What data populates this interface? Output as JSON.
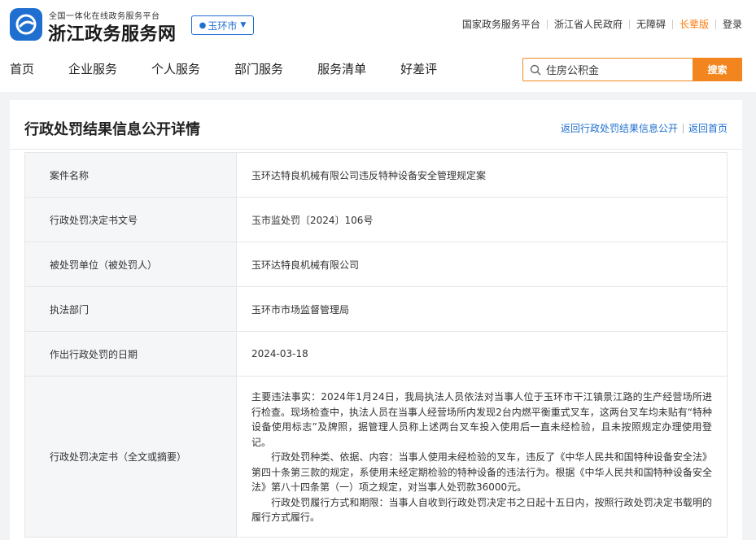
{
  "header": {
    "slogan": "全国一体化在线政务服务平台",
    "site_name": "浙江政务服务网",
    "city": "玉环市",
    "top_links": [
      "国家政务服务平台",
      "浙江省人民政府",
      "无障碍",
      "长辈版",
      "登录"
    ]
  },
  "nav": [
    "首页",
    "企业服务",
    "个人服务",
    "部门服务",
    "服务清单",
    "好差评"
  ],
  "search": {
    "value": "住房公积金",
    "button": "搜索"
  },
  "page": {
    "title": "行政处罚结果信息公开详情",
    "back_link": "返回行政处罚结果信息公开",
    "home_link": "返回首页"
  },
  "rows": [
    {
      "label": "案件名称",
      "value": "玉环达特良机械有限公司违反特种设备安全管理规定案"
    },
    {
      "label": "行政处罚决定书文号",
      "value": "玉市监处罚〔2024〕106号"
    },
    {
      "label": "被处罚单位（被处罚人）",
      "value": "玉环达特良机械有限公司"
    },
    {
      "label": "执法部门",
      "value": "玉环市市场监督管理局"
    },
    {
      "label": "作出行政处罚的日期",
      "value": "2024-03-18"
    }
  ],
  "decision": {
    "label": "行政处罚决定书（全文或摘要）",
    "paragraphs": [
      "主要违法事实：2024年1月24日，我局执法人员依法对当事人位于玉环市干江镇景江路的生产经营场所进行检查。现场检查中，执法人员在当事人经营场所内发现2台内燃平衡重式叉车，这两台叉车均未贴有“特种设备使用标志”及牌照，据管理人员称上述两台叉车投入使用后一直未经检验，且未按照规定办理使用登记。",
      "　　行政处罚种类、依据、内容：当事人使用未经检验的叉车，违反了《中华人民共和国特种设备安全法》第四十条第三款的规定，系使用未经定期检验的特种设备的违法行为。根据《中华人民共和国特种设备安全法》第八十四条第（一）项之规定，对当事人处罚款36000元。",
      "　　行政处罚履行方式和期限：当事人自收到行政处罚决定书之日起十五日内，按照行政处罚决定书载明的履行方式履行。"
    ]
  },
  "colors": {
    "brand_blue": "#1f6fd0",
    "accent_orange": "#f2851d"
  }
}
